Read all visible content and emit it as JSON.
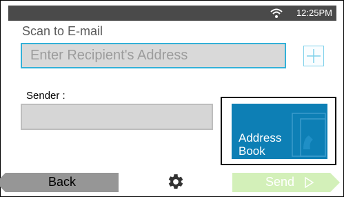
{
  "status_bar": {
    "time": "12:25PM",
    "wifi_icon": "wifi-icon"
  },
  "title": "Scan to E-mail",
  "recipient": {
    "placeholder": "Enter Recipient's Address",
    "value": ""
  },
  "add_button_icon": "plus-icon",
  "sender": {
    "label": "Sender :",
    "value": ""
  },
  "address_book": {
    "label": "Address\nBook",
    "icon": "phone-book-icon"
  },
  "footer": {
    "back_label": "Back",
    "settings_icon": "gear-icon",
    "send_label": "Send",
    "send_icon": "play-arrow-icon"
  },
  "colors": {
    "accent": "#33b1d8",
    "address_book_tile": "#0d7fb5",
    "send_button": "#d3f0b9",
    "back_button": "#969696",
    "status_bar": "#4a4a4a"
  }
}
